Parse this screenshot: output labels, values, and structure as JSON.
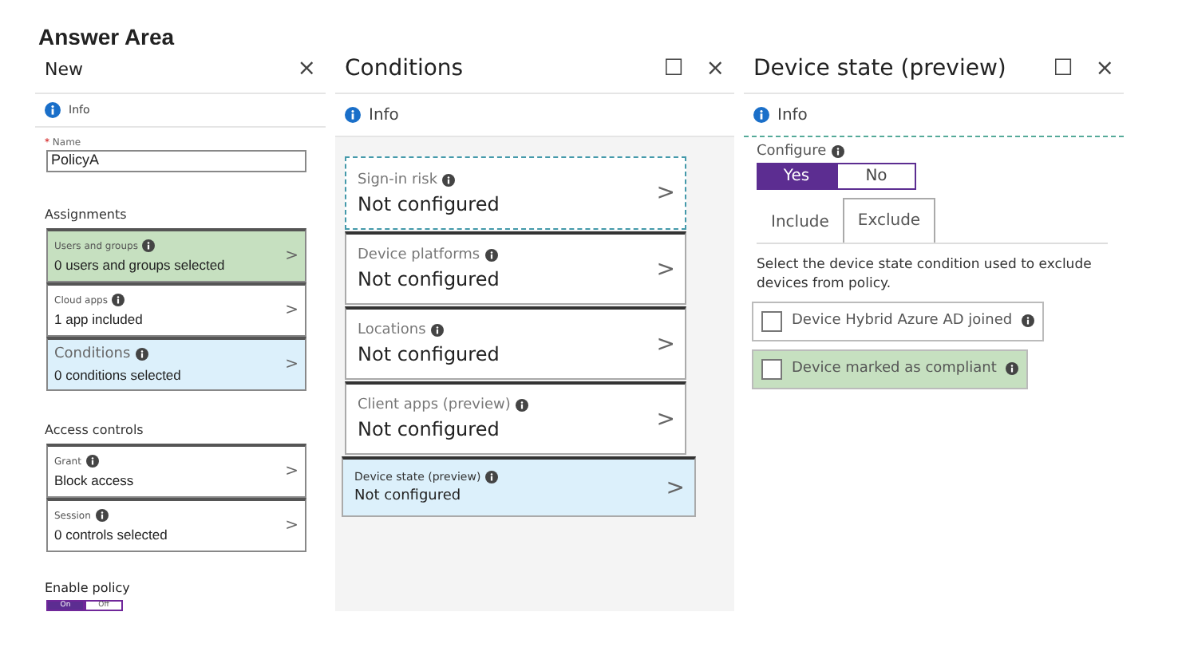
{
  "heading": "Answer Area",
  "new_blade": {
    "title": "New",
    "close": "×",
    "info": "Info",
    "name_label": "Name",
    "required_mark": "*",
    "name_value": "PolicyA",
    "sections": [
      {
        "title": "Assignments",
        "items": [
          {
            "label": "Users and groups",
            "kind": "small",
            "value": "0 users and groups selected",
            "color": "#c6e0c0",
            "chevron": ">"
          },
          {
            "label": "Cloud apps",
            "kind": "small",
            "value": "1 app included",
            "chevron": ">"
          },
          {
            "label": "Conditions",
            "kind": "large",
            "value": "0 conditions selected",
            "color": "#dcf0fb",
            "chevron": ">"
          }
        ]
      },
      {
        "title": "Access controls",
        "items": [
          {
            "label": "Grant",
            "kind": "small",
            "value": "Block access",
            "chevron": ">"
          },
          {
            "label": "Session",
            "kind": "small",
            "value": "0 controls selected",
            "chevron": ">"
          }
        ]
      }
    ],
    "enable_label": "Enable policy",
    "enable_options": [
      {
        "label": "On",
        "selected": true
      },
      {
        "label": "Off",
        "selected": false
      }
    ]
  },
  "conditions_blade": {
    "title": "Conditions",
    "maximize": "☐",
    "close": "×",
    "info": "Info",
    "items": [
      {
        "label": "Sign-in risk",
        "value": "Not configured",
        "chevron": ">"
      },
      {
        "label": "Device platforms",
        "value": "Not configured",
        "chevron": ">"
      },
      {
        "label": "Locations",
        "value": "Not configured",
        "chevron": ">"
      },
      {
        "label": "Client apps (preview)",
        "value": "Not configured",
        "chevron": ">"
      },
      {
        "label": "Device state (preview)",
        "value": "Not configured",
        "chevron": ">",
        "color": "#dcf0fb"
      }
    ]
  },
  "device_state_blade": {
    "title": "Device state (preview)",
    "maximize": "☐",
    "close": "×",
    "info": "Info",
    "configure_label": "Configure",
    "configure_options": [
      {
        "label": "Yes",
        "selected": true
      },
      {
        "label": "No",
        "selected": false
      }
    ],
    "tabs": [
      {
        "label": "Include",
        "selected": false
      },
      {
        "label": "Exclude",
        "selected": true
      }
    ],
    "description": "Select the device state condition used to exclude devices from policy.",
    "checkboxes": [
      {
        "label": "Device Hybrid Azure AD joined",
        "checked": false
      },
      {
        "label": "Device marked as compliant",
        "checked": false,
        "color": "#c6e0c0"
      }
    ]
  }
}
